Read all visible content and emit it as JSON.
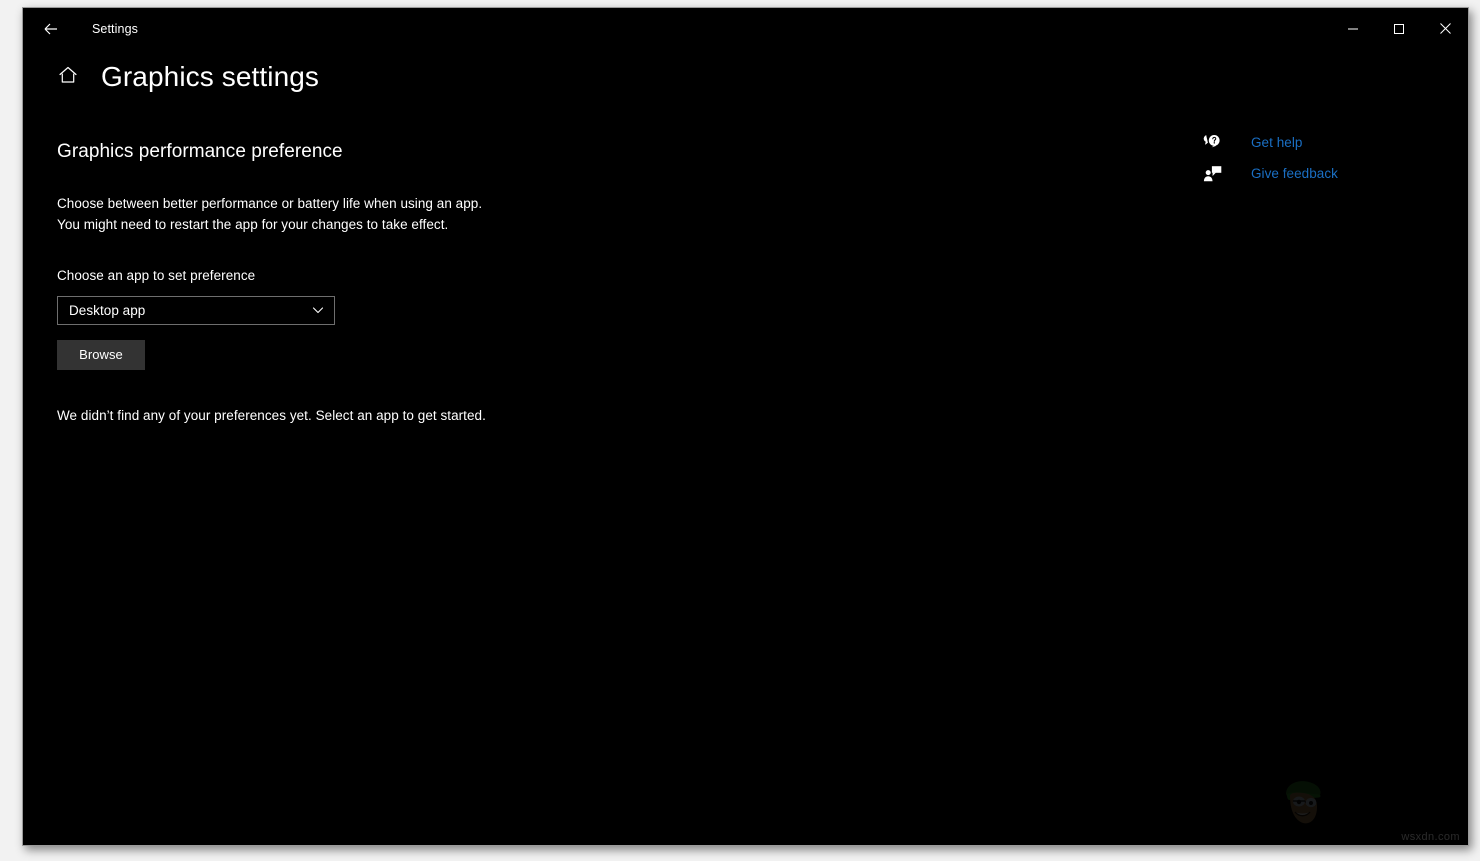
{
  "window": {
    "app_title": "Settings",
    "back_icon": "back-arrow-icon",
    "minimize_icon": "minimize-icon",
    "maximize_icon": "maximize-icon",
    "close_icon": "close-icon"
  },
  "header": {
    "home_icon": "home-icon",
    "page_title": "Graphics settings"
  },
  "main": {
    "section_heading": "Graphics performance preference",
    "description_line1": "Choose between better performance or battery life when using an app.",
    "description_line2": "You might need to restart the app for your changes to take effect.",
    "field_label": "Choose an app to set preference",
    "dropdown": {
      "value": "Desktop app",
      "chevron_icon": "chevron-down-icon",
      "options": [
        "Desktop app"
      ]
    },
    "browse_label": "Browse",
    "empty_state": "We didn’t find any of your preferences yet. Select an app to get started."
  },
  "right_rail": {
    "links": [
      {
        "label": "Get help",
        "icon": "help-bubble-icon"
      },
      {
        "label": "Give feedback",
        "icon": "feedback-person-icon"
      }
    ]
  },
  "watermark": {
    "text": "wsxdn.com",
    "logo_icon": "face-with-green-cap-logo"
  },
  "colors": {
    "window_background": "#000000",
    "desktop_background": "#f2f2f2",
    "text_primary": "#ffffff",
    "link_blue": "#1a6fc4",
    "button_fill": "#333333",
    "control_border": "#6e6e6e",
    "window_border": "#9a9a9a"
  }
}
